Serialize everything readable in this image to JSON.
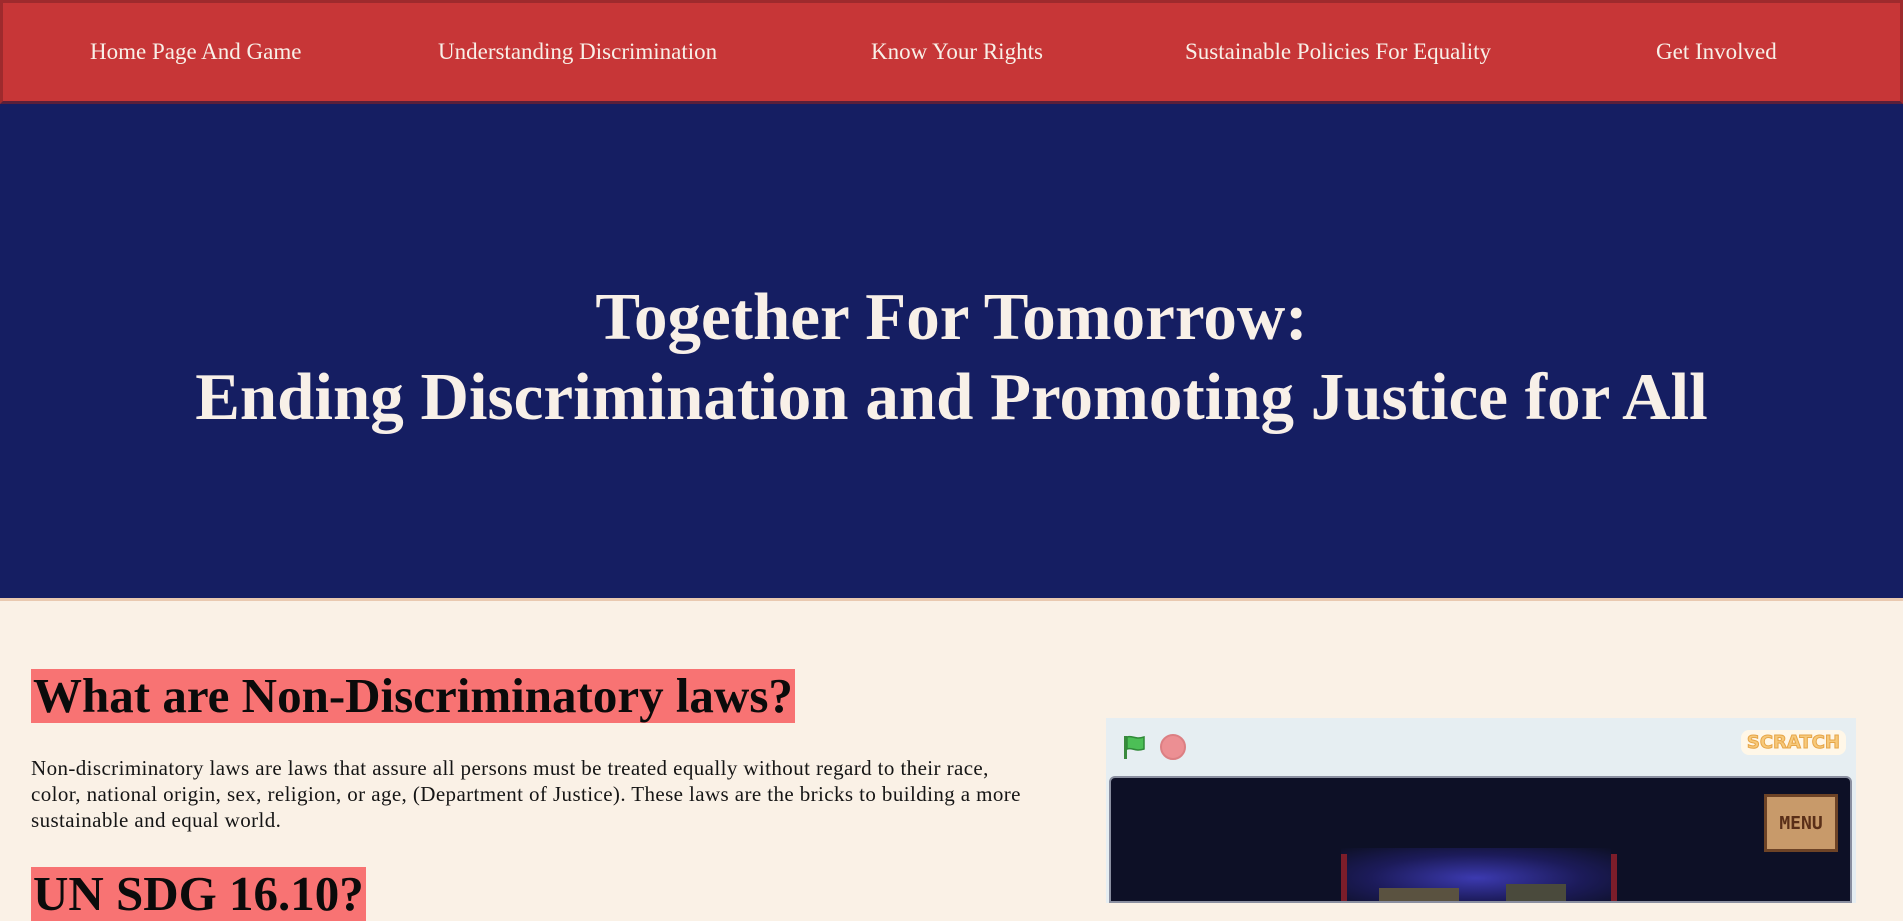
{
  "nav": {
    "items": [
      {
        "label": "Home Page And Game"
      },
      {
        "label": "Understanding Discrimination"
      },
      {
        "label": "Know Your Rights"
      },
      {
        "label": "Sustainable Policies For Equality"
      },
      {
        "label": "Get Involved"
      }
    ]
  },
  "hero": {
    "title_line1": "Together For Tomorrow:",
    "title_line2": "Ending Discrimination and Promoting Justice for All"
  },
  "section1": {
    "heading": "What are Non-Discriminatory laws?",
    "paragraph": "Non-discriminatory laws are laws that assure all persons must be treated equally without regard to their race, color, national origin, sex, religion, or age, (Department of Justice). These laws are the bricks to building a more sustainable and equal world."
  },
  "section2": {
    "heading": "UN SDG 16.10?"
  },
  "scratch_player": {
    "logo_text": "SCRATCH",
    "menu_label": "MENU"
  },
  "colors": {
    "nav_bg": "#c73637",
    "hero_bg": "#151e62",
    "page_bg": "#faf1e6",
    "heading_highlight": "#f87373"
  }
}
